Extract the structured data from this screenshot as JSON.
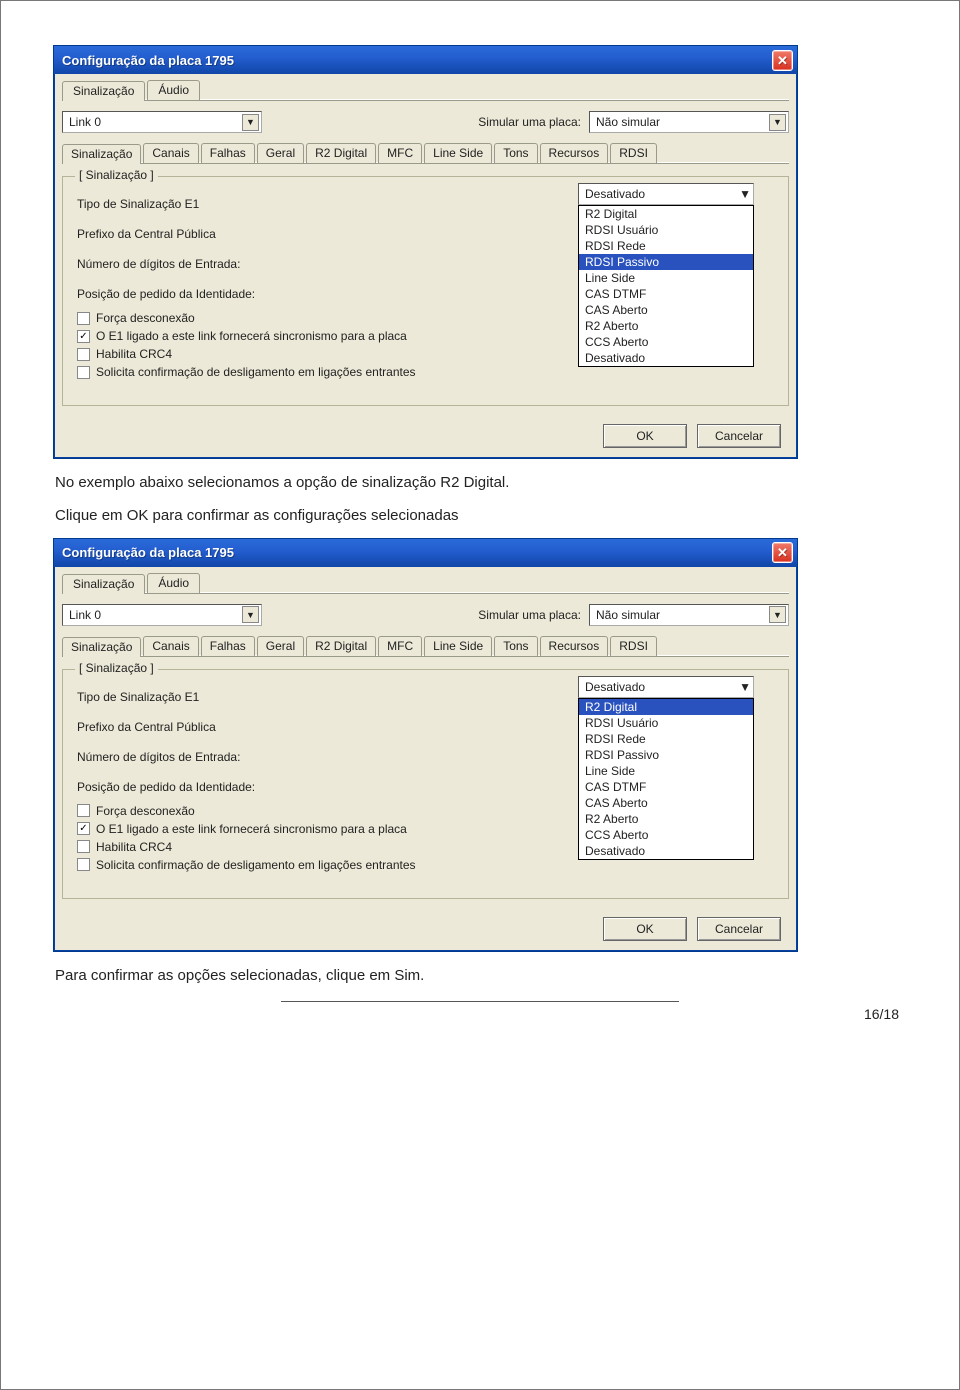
{
  "captions": {
    "line1": "No exemplo abaixo selecionamos a opção de sinalização R2 Digital.",
    "line2": "Clique em OK para confirmar as configurações selecionadas",
    "line3": "Para confirmar as opções selecionadas, clique em Sim."
  },
  "window_title": "Configuração da placa 1795",
  "top_tabs": [
    "Sinalização",
    "Áudio"
  ],
  "link_combo": "Link 0",
  "simular_label": "Simular uma placa:",
  "simular_value": "Não simular",
  "sub_tabs": [
    "Sinalização",
    "Canais",
    "Falhas",
    "Geral",
    "R2 Digital",
    "MFC",
    "Line Side",
    "Tons",
    "Recursos",
    "RDSI"
  ],
  "group_legend": "[ Sinalização ]",
  "labels": {
    "tipo": "Tipo de Sinalização E1",
    "prefixo": "Prefixo da Central Pública",
    "numdig": "Número de dígitos de Entrada:",
    "posicao": "Posição de pedido da Identidade:"
  },
  "checks": {
    "forca": "Força desconexão",
    "e1": "O E1 ligado a este link fornecerá sincronismo para a placa",
    "crc4": "Habilita CRC4",
    "sol": "Solicita confirmação de desligamento em ligações entrantes"
  },
  "dropdown_closed": "Desativado",
  "options": [
    "R2 Digital",
    "RDSI Usuário",
    "RDSI Rede",
    "RDSI Passivo",
    "Line Side",
    "CAS DTMF",
    "CAS Aberto",
    "R2 Aberto",
    "CCS Aberto",
    "Desativado"
  ],
  "selected_option_win1": "RDSI Passivo",
  "selected_option_win2": "R2 Digital",
  "buttons": {
    "ok": "OK",
    "cancel": "Cancelar"
  },
  "page_number": "16/18"
}
